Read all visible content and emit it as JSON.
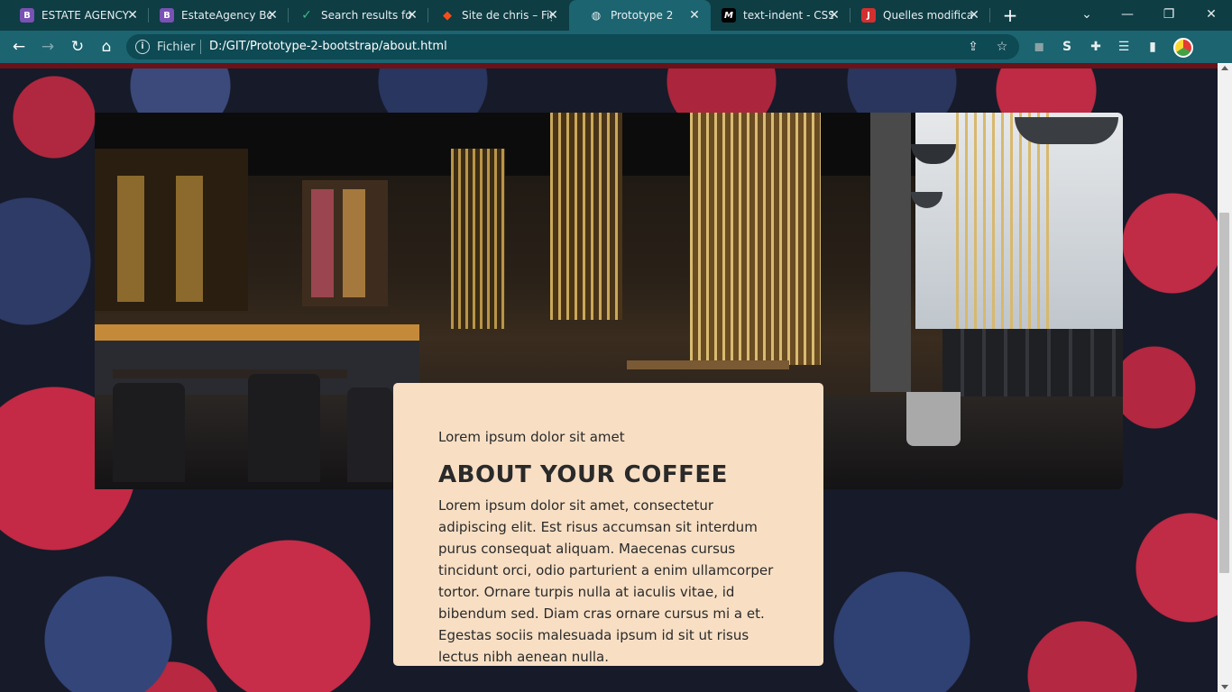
{
  "browser": {
    "tabs": [
      {
        "label": "ESTATE AGENCY",
        "favicon_text": "B",
        "favicon_color": "#7952b3"
      },
      {
        "label": "EstateAgency Bo",
        "favicon_text": "B",
        "favicon_color": "#7952b3"
      },
      {
        "label": "Search results for",
        "favicon_text": "✓",
        "favicon_color": "#41b883"
      },
      {
        "label": "Site de chris – Fig",
        "favicon_text": "◆",
        "favicon_color": "#f24e1e"
      },
      {
        "label": "Prototype 2",
        "favicon_text": "🌐",
        "favicon_color": "#1b6470",
        "active": true
      },
      {
        "label": "text-indent - CSS",
        "favicon_text": "M",
        "favicon_color": "#000000"
      },
      {
        "label": "Quelles modificat",
        "favicon_text": "J",
        "favicon_color": "#d32f2f"
      }
    ],
    "new_tab_symbol": "+",
    "address": {
      "scheme_label": "Fichier",
      "url": "D:/GIT/Prototype-2-bootstrap/about.html"
    }
  },
  "page": {
    "caption_subtitle": "Lorem ipsum dolor sit amet",
    "caption_title": "ABOUT YOUR COFFEE",
    "caption_body": "Lorem ipsum dolor sit amet, consectetur adipiscing elit. Est risus accumsan sit interdum purus consequat aliquam. Maecenas cursus tincidunt orci, odio parturient a enim ullamcorper tortor. Ornare turpis nulla at iaculis vitae, id bibendum sed. Diam cras ornare cursus mi a et. Egestas sociis malesuada ipsum id sit ut risus lectus nibh aenean nulla."
  },
  "colors": {
    "tabbar": "#0e3d44",
    "toolbar": "#1b6470",
    "caption_bg": "#f8dfc4"
  },
  "icons": [
    "back-icon",
    "forward-icon",
    "reload-icon",
    "home-icon",
    "info-icon",
    "share-icon",
    "star-icon",
    "extension-icon",
    "puzzle-icon",
    "playlist-icon",
    "sidepanel-icon",
    "profile-avatar"
  ]
}
